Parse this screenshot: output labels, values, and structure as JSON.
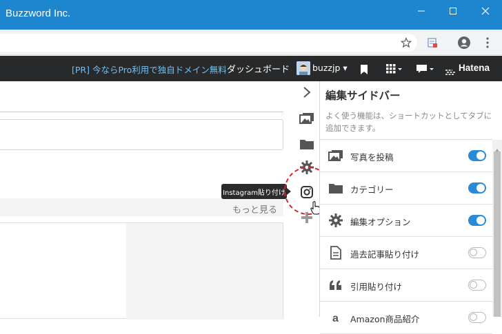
{
  "window": {
    "title": "Buzzword Inc."
  },
  "navbar": {
    "pr_text": "[PR] 今ならPro利用で独自ドメイン無料",
    "dashboard": "ダッシュボード",
    "username": "buzzjp",
    "brand": "Hatena"
  },
  "content": {
    "more_link": "もっと見る"
  },
  "tooltip": {
    "text": "Instagram貼り付け"
  },
  "sidebar": {
    "title": "編集サイドバー",
    "description": "よく使う機能は、ショートカットとしてタブに追加できます。",
    "items": [
      {
        "label": "写真を投稿",
        "icon": "photo-icon",
        "enabled": true
      },
      {
        "label": "カテゴリー",
        "icon": "folder-icon",
        "enabled": true
      },
      {
        "label": "編集オプション",
        "icon": "gear-icon",
        "enabled": true
      },
      {
        "label": "過去記事貼り付け",
        "icon": "document-icon",
        "enabled": false
      },
      {
        "label": "引用貼り付け",
        "icon": "quote-icon",
        "enabled": false
      },
      {
        "label": "Amazon商品紹介",
        "icon": "amazon-icon",
        "enabled": false
      }
    ]
  },
  "colors": {
    "titlebar": "#1e86cf",
    "navbar": "#27292b",
    "pr_link": "#6fc2f5",
    "toggle_on": "#2a8ad8",
    "highlight_circle": "#e0202a"
  }
}
